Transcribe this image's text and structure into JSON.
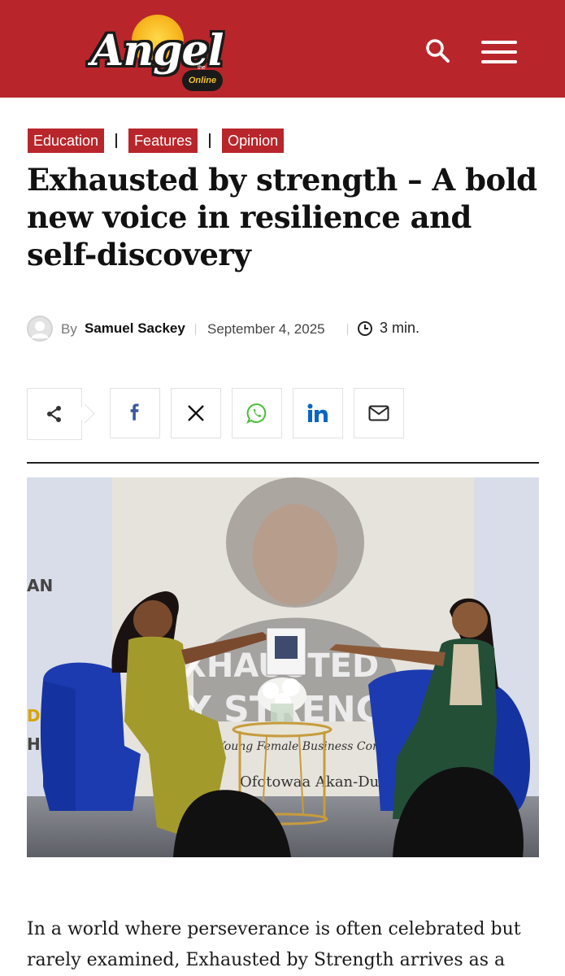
{
  "header": {
    "logo_text": "Angel",
    "logo_sub": "Online",
    "logo_the": "the",
    "brand_color": "#b8262b",
    "search_icon": "search-icon",
    "menu_icon": "hamburger-menu-icon"
  },
  "categories": [
    {
      "label": "Education"
    },
    {
      "label": "Features"
    },
    {
      "label": "Opinion"
    }
  ],
  "article": {
    "title": "Exhausted by strength – A bold new voice in resilience and self-discovery",
    "by_label": "By",
    "author": "Samuel Sackey",
    "date": "September 4, 2025",
    "read_time": "3 min.",
    "intro": "In a world where perseverance is often celebrated but rarely examined, Exhausted by Strength arrives as a"
  },
  "share": {
    "main_icon": "share-icon",
    "buttons": [
      {
        "name": "facebook-icon"
      },
      {
        "name": "x-icon"
      },
      {
        "name": "whatsapp-icon"
      },
      {
        "name": "linkedin-icon"
      },
      {
        "name": "email-icon"
      }
    ]
  },
  "photo": {
    "banner_text_1": "XHAUSTED",
    "banner_text_2": "Y STRENGTH",
    "banner_sub": "a Young Female Business Cons",
    "banner_name": "Ofotowaa Akan-Dur",
    "side_text_1": "AN",
    "side_text_2": "D",
    "side_text_3": "H"
  }
}
